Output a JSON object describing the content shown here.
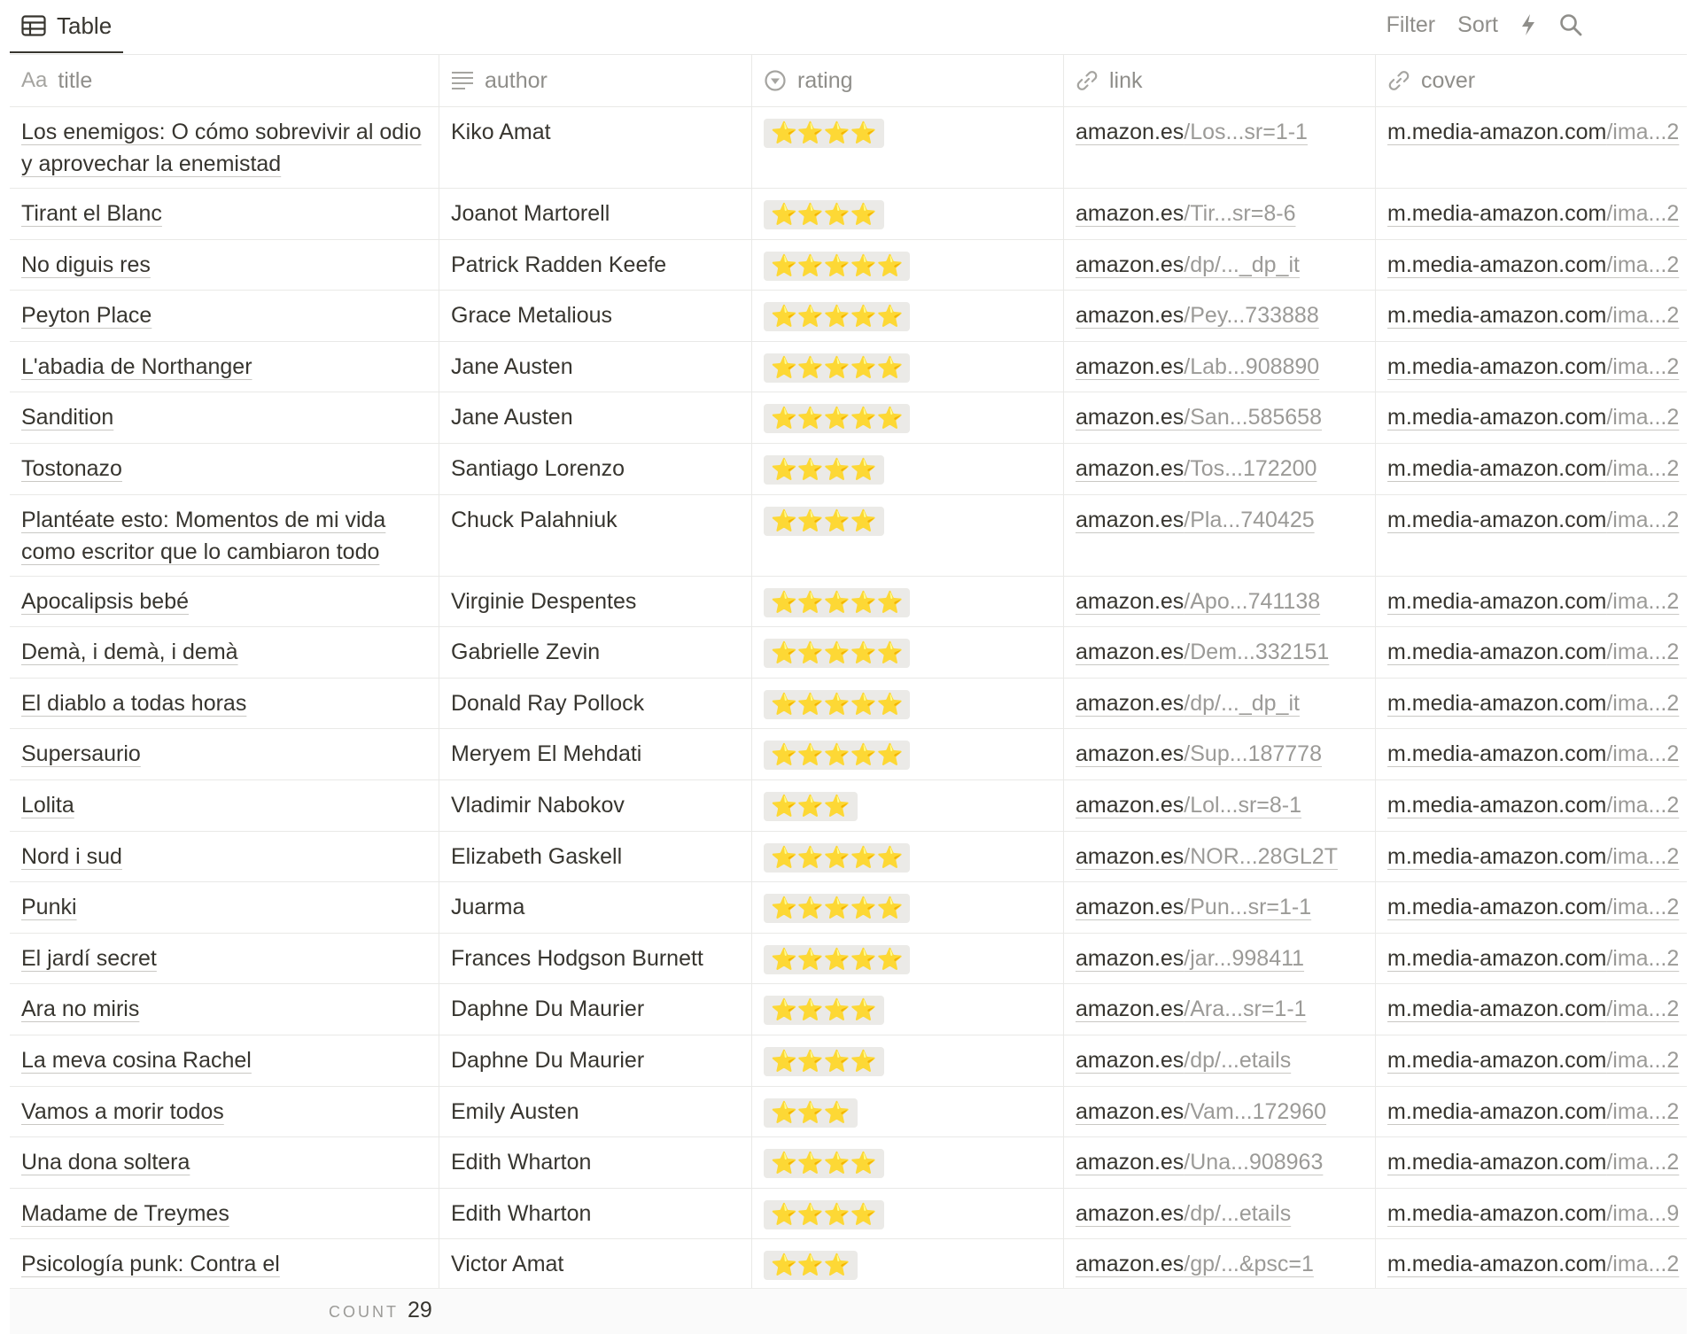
{
  "view": {
    "tab_label": "Table"
  },
  "toolbar": {
    "filter_label": "Filter",
    "sort_label": "Sort",
    "bolt_icon": "lightning-bolt-icon",
    "search_icon": "search-icon"
  },
  "columns": [
    {
      "key": "title",
      "label": "title",
      "icon": "text-aa-icon"
    },
    {
      "key": "author",
      "label": "author",
      "icon": "text-lines-icon"
    },
    {
      "key": "rating",
      "label": "rating",
      "icon": "select-circle-icon"
    },
    {
      "key": "link",
      "label": "link",
      "icon": "link-icon"
    },
    {
      "key": "cover",
      "label": "cover",
      "icon": "link-icon"
    }
  ],
  "rows": [
    {
      "title": "Los enemigos: O cómo sobrevivir al odio y aprovechar la enemistad",
      "author": "Kiko Amat",
      "rating": "⭐⭐⭐⭐",
      "link_domain": "amazon.es",
      "link_path": "/Los...sr=1-1",
      "cover_domain": "m.media-amazon.com",
      "cover_path": "/ima...2"
    },
    {
      "title": "Tirant el Blanc",
      "author": "Joanot Martorell",
      "rating": "⭐⭐⭐⭐",
      "link_domain": "amazon.es",
      "link_path": "/Tir...sr=8-6",
      "cover_domain": "m.media-amazon.com",
      "cover_path": "/ima...2"
    },
    {
      "title": "No diguis res",
      "author": "Patrick Radden Keefe",
      "rating": "⭐⭐⭐⭐⭐",
      "link_domain": "amazon.es",
      "link_path": "/dp/..._dp_it",
      "cover_domain": "m.media-amazon.com",
      "cover_path": "/ima...2"
    },
    {
      "title": "Peyton Place",
      "author": "Grace Metalious",
      "rating": "⭐⭐⭐⭐⭐",
      "link_domain": "amazon.es",
      "link_path": "/Pey...733888",
      "cover_domain": "m.media-amazon.com",
      "cover_path": "/ima...2"
    },
    {
      "title": "L'abadia de Northanger",
      "author": "Jane Austen",
      "rating": "⭐⭐⭐⭐⭐",
      "link_domain": "amazon.es",
      "link_path": "/Lab...908890",
      "cover_domain": "m.media-amazon.com",
      "cover_path": "/ima...2"
    },
    {
      "title": "Sandition",
      "author": "Jane Austen",
      "rating": "⭐⭐⭐⭐⭐",
      "link_domain": "amazon.es",
      "link_path": "/San...585658",
      "cover_domain": "m.media-amazon.com",
      "cover_path": "/ima...2"
    },
    {
      "title": "Tostonazo",
      "author": "Santiago Lorenzo",
      "rating": "⭐⭐⭐⭐",
      "link_domain": "amazon.es",
      "link_path": "/Tos...172200",
      "cover_domain": "m.media-amazon.com",
      "cover_path": "/ima...2"
    },
    {
      "title": "Plantéate esto: Momentos de mi vida como escritor que lo cambiaron todo",
      "author": "Chuck Palahniuk",
      "rating": "⭐⭐⭐⭐",
      "link_domain": "amazon.es",
      "link_path": "/Pla...740425",
      "cover_domain": "m.media-amazon.com",
      "cover_path": "/ima...2"
    },
    {
      "title": "Apocalipsis bebé",
      "author": "Virginie Despentes",
      "rating": "⭐⭐⭐⭐⭐",
      "link_domain": "amazon.es",
      "link_path": "/Apo...741138",
      "cover_domain": "m.media-amazon.com",
      "cover_path": "/ima...2"
    },
    {
      "title": "Demà, i demà, i demà",
      "author": "Gabrielle Zevin",
      "rating": "⭐⭐⭐⭐⭐",
      "link_domain": "amazon.es",
      "link_path": "/Dem...332151",
      "cover_domain": "m.media-amazon.com",
      "cover_path": "/ima...2"
    },
    {
      "title": "El diablo a todas horas",
      "author": "Donald Ray Pollock",
      "rating": "⭐⭐⭐⭐⭐",
      "link_domain": "amazon.es",
      "link_path": "/dp/..._dp_it",
      "cover_domain": "m.media-amazon.com",
      "cover_path": "/ima...2"
    },
    {
      "title": "Supersaurio",
      "author": "Meryem El Mehdati",
      "rating": "⭐⭐⭐⭐⭐",
      "link_domain": "amazon.es",
      "link_path": "/Sup...187778",
      "cover_domain": "m.media-amazon.com",
      "cover_path": "/ima...2"
    },
    {
      "title": "Lolita",
      "author": "Vladimir Nabokov",
      "rating": "⭐⭐⭐",
      "link_domain": "amazon.es",
      "link_path": "/Lol...sr=8-1",
      "cover_domain": "m.media-amazon.com",
      "cover_path": "/ima...2"
    },
    {
      "title": "Nord i sud",
      "author": "Elizabeth Gaskell",
      "rating": "⭐⭐⭐⭐⭐",
      "link_domain": "amazon.es",
      "link_path": "/NOR...28GL2T",
      "cover_domain": "m.media-amazon.com",
      "cover_path": "/ima...2"
    },
    {
      "title": "Punki",
      "author": "Juarma",
      "rating": "⭐⭐⭐⭐⭐",
      "link_domain": "amazon.es",
      "link_path": "/Pun...sr=1-1",
      "cover_domain": "m.media-amazon.com",
      "cover_path": "/ima...2"
    },
    {
      "title": "El jardí secret",
      "author": "Frances Hodgson Burnett",
      "rating": "⭐⭐⭐⭐⭐",
      "link_domain": "amazon.es",
      "link_path": "/jar...998411",
      "cover_domain": "m.media-amazon.com",
      "cover_path": "/ima...2"
    },
    {
      "title": "Ara no miris",
      "author": "Daphne Du Maurier",
      "rating": "⭐⭐⭐⭐",
      "link_domain": "amazon.es",
      "link_path": "/Ara...sr=1-1",
      "cover_domain": "m.media-amazon.com",
      "cover_path": "/ima...2"
    },
    {
      "title": "La meva cosina Rachel",
      "author": "Daphne Du Maurier",
      "rating": "⭐⭐⭐⭐",
      "link_domain": "amazon.es",
      "link_path": "/dp/...etails",
      "cover_domain": "m.media-amazon.com",
      "cover_path": "/ima...2"
    },
    {
      "title": "Vamos a morir todos",
      "author": "Emily Austen",
      "rating": "⭐⭐⭐",
      "link_domain": "amazon.es",
      "link_path": "/Vam...172960",
      "cover_domain": "m.media-amazon.com",
      "cover_path": "/ima...2"
    },
    {
      "title": "Una dona soltera",
      "author": "Edith Wharton",
      "rating": "⭐⭐⭐⭐",
      "link_domain": "amazon.es",
      "link_path": "/Una...908963",
      "cover_domain": "m.media-amazon.com",
      "cover_path": "/ima...2"
    },
    {
      "title": "Madame de Treymes",
      "author": "Edith Wharton",
      "rating": "⭐⭐⭐⭐",
      "link_domain": "amazon.es",
      "link_path": "/dp/...etails",
      "cover_domain": "m.media-amazon.com",
      "cover_path": "/ima...9"
    },
    {
      "title": "Psicología punk: Contra el",
      "author": "Victor Amat",
      "rating": "⭐⭐⭐",
      "link_domain": "amazon.es",
      "link_path": "/gp/...&psc=1",
      "cover_domain": "m.media-amazon.com",
      "cover_path": "/ima...2"
    }
  ],
  "footer": {
    "count_label": "COUNT",
    "count_value": "29"
  },
  "colors": {
    "text": "#37352f",
    "muted": "#8f8e8a",
    "border": "#e9e9e7",
    "rating_pill_bg": "#ebeae7"
  }
}
